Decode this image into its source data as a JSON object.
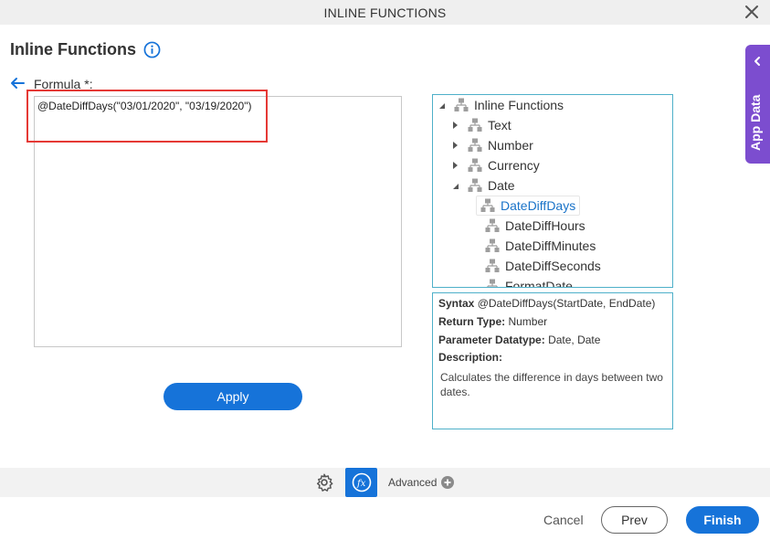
{
  "window": {
    "title": "INLINE FUNCTIONS"
  },
  "heading": {
    "title": "Inline Functions"
  },
  "formula": {
    "label": "Formula",
    "required_mark": "*:",
    "value": "@DateDiffDays(\"03/01/2020\", \"03/19/2020\")"
  },
  "apply_label": "Apply",
  "tree": {
    "root": "Inline Functions",
    "categories": [
      "Text",
      "Number",
      "Currency",
      "Date"
    ],
    "date_items": [
      "DateDiffDays",
      "DateDiffHours",
      "DateDiffMinutes",
      "DateDiffSeconds",
      "FormatDate"
    ],
    "selected": "DateDiffDays"
  },
  "description": {
    "syntax_label": "Syntax",
    "syntax_value": "@DateDiffDays(StartDate, EndDate)",
    "return_label": "Return Type:",
    "return_value": "Number",
    "param_label": "Parameter Datatype:",
    "param_value": "Date, Date",
    "desc_label": "Description:",
    "desc_text": "Calculates the difference in days between two dates."
  },
  "side_panel": {
    "label": "App Data"
  },
  "toolbar": {
    "advanced_label": "Advanced"
  },
  "footer": {
    "cancel": "Cancel",
    "prev": "Prev",
    "finish": "Finish"
  },
  "colors": {
    "primary": "#1673d9",
    "side_panel": "#7c4dcf",
    "highlight": "#e53935",
    "border": "#4eb0c9"
  },
  "icons": [
    "close-icon",
    "info-icon",
    "back-arrow-icon",
    "tree-node-icon",
    "gear-icon",
    "fx-icon",
    "plus-circle-icon",
    "chevron-left-icon"
  ]
}
